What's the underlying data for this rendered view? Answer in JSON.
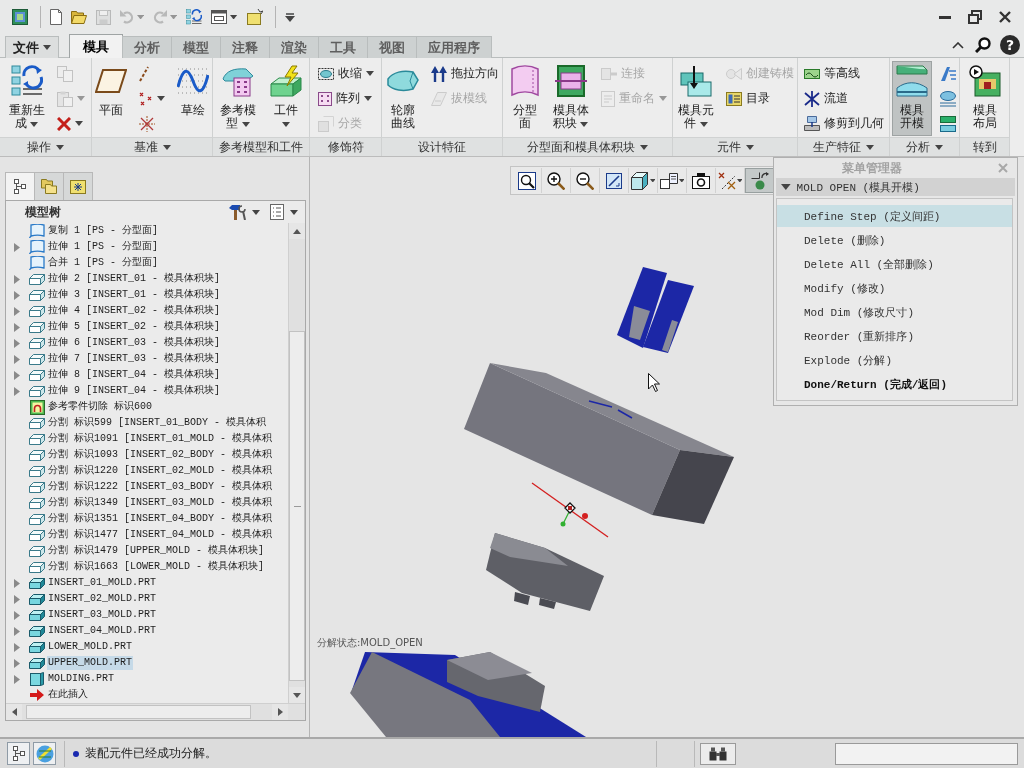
{
  "quick_access": [
    {
      "kind": "app",
      "disabled": false,
      "dropdown": false
    },
    {
      "kind": "new",
      "disabled": false,
      "dropdown": false
    },
    {
      "kind": "open",
      "disabled": false,
      "dropdown": false
    },
    {
      "kind": "save",
      "disabled": true,
      "dropdown": false
    },
    {
      "kind": "undo",
      "disabled": true,
      "dropdown": true
    },
    {
      "kind": "redo",
      "disabled": true,
      "dropdown": true
    },
    {
      "kind": "regenerate",
      "disabled": false,
      "dropdown": false
    },
    {
      "kind": "windows",
      "disabled": false,
      "dropdown": true
    },
    {
      "kind": "box",
      "disabled": false,
      "dropdown": false
    },
    {
      "kind": "customize",
      "disabled": false,
      "dropdown": false
    }
  ],
  "tabs": [
    {
      "label": "文件",
      "kind": "menu",
      "selected": false
    },
    {
      "label": "模具",
      "kind": "tab",
      "selected": true
    },
    {
      "label": "分析",
      "kind": "tab",
      "selected": false
    },
    {
      "label": "模型",
      "kind": "tab",
      "selected": false
    },
    {
      "label": "注释",
      "kind": "tab",
      "selected": false
    },
    {
      "label": "渲染",
      "kind": "tab",
      "selected": false
    },
    {
      "label": "工具",
      "kind": "tab",
      "selected": false
    },
    {
      "label": "视图",
      "kind": "tab",
      "selected": false
    },
    {
      "label": "应用程序",
      "kind": "tab",
      "selected": false
    }
  ],
  "help_button": "?",
  "ribbon": [
    {
      "label": "操作",
      "dropdown": true,
      "columns": [
        [
          {
            "kind": "regenerate",
            "lines": [
              "重新生",
              "成"
            ],
            "dropdown": true,
            "disabled": false,
            "pressed": false
          }
        ],
        [
          {
            "kind": "copy",
            "disabled": true,
            "dropdown": false
          },
          {
            "kind": "paste",
            "disabled": true,
            "dropdown": true
          },
          {
            "kind": "delete",
            "disabled": false,
            "dropdown": true
          }
        ]
      ]
    },
    {
      "label": "基准",
      "dropdown": true,
      "columns": [
        [
          {
            "kind": "plane",
            "lines": [
              "平面"
            ],
            "dropdown": false,
            "disabled": false,
            "pressed": false
          }
        ],
        [
          {
            "kind": "axis",
            "disabled": false,
            "dropdown": false
          },
          {
            "kind": "point",
            "disabled": false,
            "dropdown": true
          },
          {
            "kind": "csys",
            "disabled": false,
            "dropdown": false
          }
        ],
        [
          {
            "kind": "sketch",
            "lines": [
              "草绘"
            ],
            "dropdown": false,
            "disabled": false,
            "pressed": false
          }
        ]
      ]
    },
    {
      "label": "参考模型和工件",
      "dropdown": false,
      "columns": [
        [
          {
            "kind": "refmodel",
            "lines": [
              "参考模",
              "型"
            ],
            "dropdown": true,
            "disabled": false,
            "pressed": false
          }
        ],
        [
          {
            "kind": "workpiece",
            "lines": [
              "工件"
            ],
            "dropdown": true,
            "disabled": false,
            "pressed": false
          }
        ]
      ]
    },
    {
      "label": "修饰符",
      "dropdown": false,
      "columns": [
        [
          {
            "kind": "shrink",
            "label": "收缩",
            "disabled": false,
            "dropdown": true
          },
          {
            "kind": "pattern",
            "label": "阵列",
            "disabled": false,
            "dropdown": true
          },
          {
            "kind": "classify",
            "label": "分类",
            "disabled": true,
            "dropdown": false
          }
        ]
      ]
    },
    {
      "label": "设计特征",
      "dropdown": false,
      "columns": [
        [
          {
            "kind": "silhouette",
            "lines": [
              "轮廓",
              "曲线"
            ],
            "dropdown": false,
            "disabled": false,
            "pressed": false
          }
        ],
        [
          {
            "kind": "pulldir",
            "label": "拖拉方向",
            "disabled": false,
            "dropdown": false
          },
          {
            "kind": "draftline",
            "label": "拔模线",
            "disabled": true,
            "dropdown": false
          }
        ]
      ]
    },
    {
      "label": "分型面和模具体积块",
      "dropdown": true,
      "columns": [
        [
          {
            "kind": "partsurf",
            "lines": [
              "分型",
              "面"
            ],
            "dropdown": false,
            "disabled": false,
            "pressed": false
          }
        ],
        [
          {
            "kind": "moldvolume",
            "lines": [
              "模具体",
              "积块"
            ],
            "dropdown": true,
            "disabled": false,
            "pressed": false
          }
        ],
        [
          {
            "kind": "connect",
            "label": "连接",
            "disabled": true,
            "dropdown": false
          },
          {
            "kind": "rename",
            "label": "重命名",
            "disabled": true,
            "dropdown": true
          }
        ]
      ]
    },
    {
      "label": "元件",
      "dropdown": true,
      "columns": [
        [
          {
            "kind": "moldcomp",
            "lines": [
              "模具元",
              "件"
            ],
            "dropdown": true,
            "disabled": false,
            "pressed": false
          }
        ],
        [
          {
            "kind": "casting",
            "label": "创建铸模",
            "disabled": true,
            "dropdown": false
          },
          {
            "kind": "catalog",
            "label": "目录",
            "disabled": false,
            "dropdown": false
          }
        ]
      ]
    },
    {
      "label": "生产特征",
      "dropdown": true,
      "columns": [
        [
          {
            "kind": "contour",
            "label": "等高线",
            "disabled": false,
            "dropdown": false
          },
          {
            "kind": "runner",
            "label": "流道",
            "disabled": false,
            "dropdown": false
          },
          {
            "kind": "trim",
            "label": "修剪到几何",
            "disabled": false,
            "dropdown": false
          }
        ]
      ]
    },
    {
      "label": "分析",
      "dropdown": true,
      "columns": [
        [
          {
            "kind": "moldopen",
            "lines": [
              "模具",
              "开模"
            ],
            "dropdown": false,
            "disabled": false,
            "pressed": true
          }
        ],
        [
          {
            "kind": "draftangle",
            "disabled": false,
            "dropdown": false
          },
          {
            "kind": "thickness",
            "disabled": false,
            "dropdown": false
          },
          {
            "kind": "projarea",
            "disabled": false,
            "dropdown": false
          }
        ]
      ]
    },
    {
      "label": "转到",
      "dropdown": false,
      "columns": [
        [
          {
            "kind": "layout",
            "lines": [
              "模具",
              "布局"
            ],
            "dropdown": false,
            "disabled": false,
            "pressed": false
          }
        ]
      ]
    }
  ],
  "navigator": {
    "tabs": [
      {
        "kind": "tree",
        "selected": true
      },
      {
        "kind": "folders",
        "selected": false
      },
      {
        "kind": "favorites",
        "selected": false
      }
    ],
    "title": "模型树",
    "items": [
      {
        "label": "复制 1 [PS - 分型面]",
        "kind": "quilt",
        "expandable": false,
        "selected": false
      },
      {
        "label": "拉伸 1 [PS - 分型面]",
        "kind": "quilt",
        "expandable": true,
        "selected": false
      },
      {
        "label": "合并 1 [PS - 分型面]",
        "kind": "quilt",
        "expandable": false,
        "selected": false
      },
      {
        "label": "拉伸 2 [INSERT_01 - 模具体积块]",
        "kind": "feature",
        "expandable": true,
        "selected": false
      },
      {
        "label": "拉伸 3 [INSERT_01 - 模具体积块]",
        "kind": "feature",
        "expandable": true,
        "selected": false
      },
      {
        "label": "拉伸 4 [INSERT_02 - 模具体积块]",
        "kind": "feature",
        "expandable": true,
        "selected": false
      },
      {
        "label": "拉伸 5 [INSERT_02 - 模具体积块]",
        "kind": "feature",
        "expandable": true,
        "selected": false
      },
      {
        "label": "拉伸 6 [INSERT_03 - 模具体积块]",
        "kind": "feature",
        "expandable": true,
        "selected": false
      },
      {
        "label": "拉伸 7 [INSERT_03 - 模具体积块]",
        "kind": "feature",
        "expandable": true,
        "selected": false
      },
      {
        "label": "拉伸 8 [INSERT_04 - 模具体积块]",
        "kind": "feature",
        "expandable": true,
        "selected": false
      },
      {
        "label": "拉伸 9 [INSERT_04 - 模具体积块]",
        "kind": "feature",
        "expandable": true,
        "selected": false
      },
      {
        "label": "参考零件切除 标识600",
        "kind": "cut",
        "expandable": false,
        "selected": false
      },
      {
        "label": "分割 标识599 [INSERT_01_BODY - 模具体积",
        "kind": "feature",
        "expandable": false,
        "selected": false
      },
      {
        "label": "分割 标识1091 [INSERT_01_MOLD - 模具体积",
        "kind": "feature",
        "expandable": false,
        "selected": false
      },
      {
        "label": "分割 标识1093 [INSERT_02_BODY - 模具体积",
        "kind": "feature",
        "expandable": false,
        "selected": false
      },
      {
        "label": "分割 标识1220 [INSERT_02_MOLD - 模具体积",
        "kind": "feature",
        "expandable": false,
        "selected": false
      },
      {
        "label": "分割 标识1222 [INSERT_03_BODY - 模具体积",
        "kind": "feature",
        "expandable": false,
        "selected": false
      },
      {
        "label": "分割 标识1349 [INSERT_03_MOLD - 模具体积",
        "kind": "feature",
        "expandable": false,
        "selected": false
      },
      {
        "label": "分割 标识1351 [INSERT_04_BODY - 模具体积",
        "kind": "feature",
        "expandable": false,
        "selected": false
      },
      {
        "label": "分割 标识1477 [INSERT_04_MOLD - 模具体积",
        "kind": "feature",
        "expandable": false,
        "selected": false
      },
      {
        "label": "分割 标识1479 [UPPER_MOLD - 模具体积块]",
        "kind": "feature",
        "expandable": false,
        "selected": false
      },
      {
        "label": "分割 标识1663 [LOWER_MOLD - 模具体积块]",
        "kind": "feature",
        "expandable": false,
        "selected": false
      },
      {
        "label": "INSERT_01_MOLD.PRT",
        "kind": "part",
        "expandable": true,
        "selected": false
      },
      {
        "label": "INSERT_02_MOLD.PRT",
        "kind": "part",
        "expandable": true,
        "selected": false
      },
      {
        "label": "INSERT_03_MOLD.PRT",
        "kind": "part",
        "expandable": true,
        "selected": false
      },
      {
        "label": "INSERT_04_MOLD.PRT",
        "kind": "part",
        "expandable": true,
        "selected": false
      },
      {
        "label": "LOWER_MOLD.PRT",
        "kind": "part",
        "expandable": true,
        "selected": false
      },
      {
        "label": "UPPER_MOLD.PRT",
        "kind": "part",
        "expandable": true,
        "selected": true
      },
      {
        "label": "MOLDING.PRT",
        "kind": "workpiece",
        "expandable": true,
        "selected": false
      },
      {
        "label": "在此插入",
        "kind": "insert",
        "expandable": false,
        "selected": false
      }
    ]
  },
  "view_toolbar": [
    {
      "kind": "refit",
      "pressed": false,
      "dropdown": false
    },
    {
      "kind": "zoomin",
      "pressed": false,
      "dropdown": false
    },
    {
      "kind": "zoomout",
      "pressed": false,
      "dropdown": false
    },
    {
      "kind": "repaint",
      "pressed": false,
      "dropdown": false
    },
    {
      "kind": "display",
      "pressed": false,
      "dropdown": true
    },
    {
      "kind": "savedviews",
      "pressed": false,
      "dropdown": true
    },
    {
      "kind": "viewmanager",
      "pressed": false,
      "dropdown": false
    },
    {
      "kind": "datum",
      "pressed": false,
      "dropdown": true
    },
    {
      "kind": "spincenter",
      "pressed": true,
      "dropdown": false
    }
  ],
  "canvas": {
    "label": "分解状态:MOLD_OPEN"
  },
  "menu_manager": {
    "title": "菜单管理器",
    "menu": {
      "label": "MOLD OPEN (模具开模)",
      "expanded": true
    },
    "items": [
      {
        "label": "Define Step (定义间距)",
        "selected": true,
        "bold": false
      },
      {
        "label": "Delete (删除)",
        "selected": false,
        "bold": false
      },
      {
        "label": "Delete All (全部删除)",
        "selected": false,
        "bold": false
      },
      {
        "label": "Modify (修改)",
        "selected": false,
        "bold": false
      },
      {
        "label": "Mod Dim (修改尺寸)",
        "selected": false,
        "bold": false
      },
      {
        "label": "Reorder (重新排序)",
        "selected": false,
        "bold": false
      },
      {
        "label": "Explode (分解)",
        "selected": false,
        "bold": false
      },
      {
        "label": "Done/Return (完成/返回)",
        "selected": false,
        "bold": true
      }
    ]
  },
  "status_bar": {
    "toggles": [
      {
        "kind": "tree",
        "on": true
      },
      {
        "kind": "browser",
        "on": true
      }
    ],
    "message": "装配元件已经成功分解。"
  }
}
